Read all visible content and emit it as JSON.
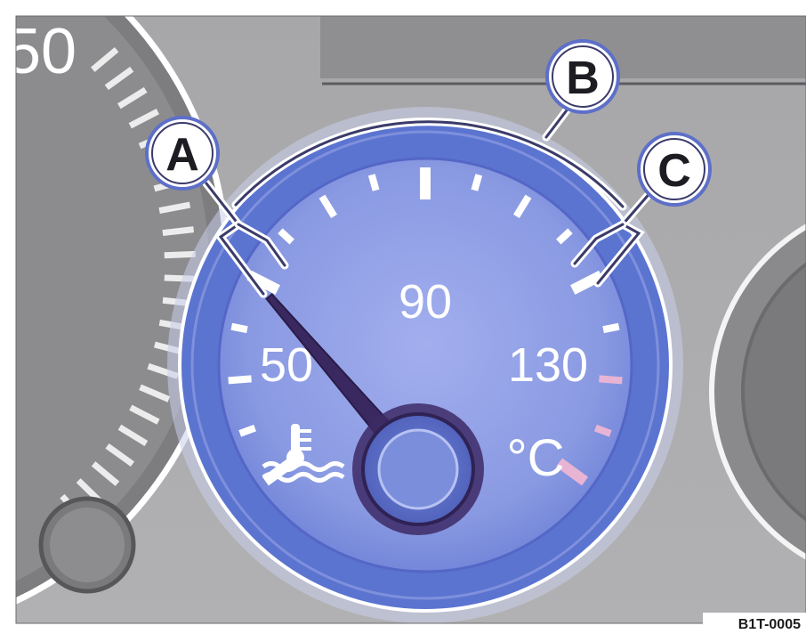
{
  "figure": {
    "left_gauge_partial_number": "50",
    "figure_id": "B1T-0005"
  },
  "gauge": {
    "name": "coolant temperature gauge",
    "scale_labels": {
      "low": "50",
      "mid": "90",
      "high": "130"
    },
    "unit": "°C",
    "needle_reading": 50,
    "scale_min": 50,
    "scale_max": 130,
    "icon": "coolant-temperature-icon",
    "colors": {
      "dial_ring": "#5b74d0",
      "dial_face": "#8e9ee4",
      "needle": "#3a2860",
      "red_zone_ticks": "#e8b4d4",
      "background": "#a9a9aa"
    }
  },
  "callouts": {
    "a": "A",
    "b": "B",
    "c": "C"
  }
}
